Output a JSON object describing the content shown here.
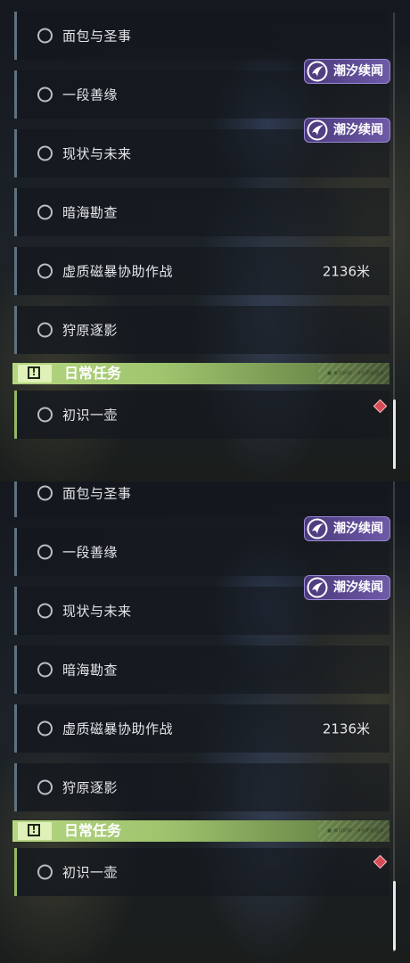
{
  "panels": [
    {
      "quests": [
        {
          "title": "面包与圣事",
          "distance": "",
          "badge": ""
        },
        {
          "title": "一段善缘",
          "distance": "",
          "badge": "潮汐续闻"
        },
        {
          "title": "现状与未来",
          "distance": "",
          "badge": "潮汐续闻"
        },
        {
          "title": "暗海勘查",
          "distance": "",
          "badge": ""
        },
        {
          "title": "虚质磁暴协助作战",
          "distance": "2136米",
          "badge": ""
        },
        {
          "title": "狩原逐影",
          "distance": "",
          "badge": ""
        }
      ],
      "daily_section": {
        "title": "日常任务",
        "icon_glyph": "!",
        "tiny_text": "■ 每日刷新 · 4点更新显示"
      },
      "daily_quests": [
        {
          "title": "初识一壶"
        }
      ]
    },
    {
      "quests": [
        {
          "title": "面包与圣事",
          "distance": "",
          "badge": ""
        },
        {
          "title": "一段善缘",
          "distance": "",
          "badge": "潮汐续闻"
        },
        {
          "title": "现状与未来",
          "distance": "",
          "badge": "潮汐续闻"
        },
        {
          "title": "暗海勘查",
          "distance": "",
          "badge": ""
        },
        {
          "title": "虚质磁暴协助作战",
          "distance": "2136米",
          "badge": ""
        },
        {
          "title": "狩原逐影",
          "distance": "",
          "badge": ""
        }
      ],
      "daily_section": {
        "title": "日常任务",
        "icon_glyph": "!",
        "tiny_text": "■ 每日刷新 · 4点更新显示"
      },
      "daily_quests": [
        {
          "title": "初识一壶"
        }
      ]
    }
  ],
  "colors": {
    "quest_bar": "#5f7280",
    "daily_bar": "#94b864",
    "badge": "#6e5aa8",
    "alert": "#d94a57"
  },
  "icons": {
    "quest_status": "circle-icon",
    "badge_logo": "tide-logo-icon",
    "daily_header": "exclamation-box-icon",
    "alert": "red-diamond-icon"
  }
}
